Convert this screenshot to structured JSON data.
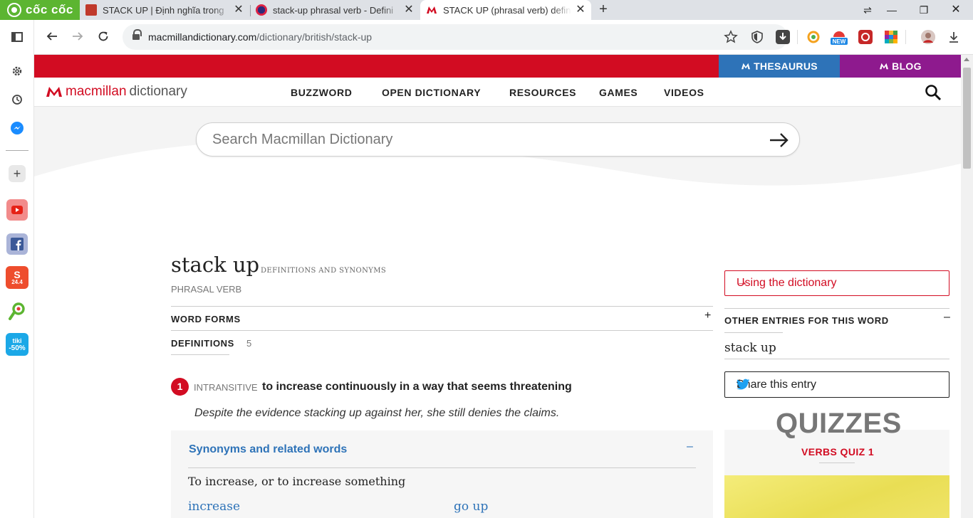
{
  "browser": {
    "brand": "cốc cốc",
    "tabs": [
      {
        "title": "STACK UP | Định nghĩa trong",
        "active": false
      },
      {
        "title": "stack-up phrasal verb - Defini",
        "active": false
      },
      {
        "title": "STACK UP (phrasal verb) defin",
        "active": true
      }
    ],
    "url_domain": "macmillandictionary.com",
    "url_path": "/dictionary/british/stack-up"
  },
  "sidebar": {
    "items": [
      "settings-icon",
      "history-icon",
      "messenger-icon",
      "add-icon",
      "youtube-icon",
      "facebook-icon",
      "shopee-icon",
      "cococ-map-icon",
      "tiki-icon"
    ],
    "shopee_badge": "24.4",
    "tiki_label": "tiki",
    "tiki_badge": "-50%"
  },
  "site": {
    "thesaurus": "THESAURUS",
    "blog": "BLOG",
    "logo_part1": "macmillan",
    "logo_part2": "dictionary",
    "nav": [
      "BUZZWORD",
      "OPEN DICTIONARY",
      "RESOURCES",
      "GAMES",
      "VIDEOS"
    ],
    "search_placeholder": "Search Macmillan Dictionary",
    "colors": {
      "red": "#d20c22",
      "thesaurus": "#2e73b8",
      "blog": "#8e1a8e",
      "link": "#2e73b8"
    }
  },
  "entry": {
    "headword": "stack up",
    "defsyn": "DEFINITIONS AND SYNONYMS",
    "pos": "PHRASAL VERB",
    "word_forms": "WORD FORMS",
    "definitions_label": "DEFINITIONS",
    "definitions_count": "5",
    "sense_number": "1",
    "grammar": "INTRANSITIVE",
    "definition": "to increase continuously in a way that seems threatening",
    "example": "Despite the evidence stacking up against her, she still denies the claims.",
    "synonyms_heading": "Synonyms and related words",
    "synonyms_sense": "To increase, or to increase something",
    "synonyms": [
      "increase",
      "go up"
    ]
  },
  "sidebar_right": {
    "using": "Using the dictionary",
    "other_entries": "OTHER ENTRIES FOR THIS WORD",
    "other_word": "stack up",
    "share": "Share this entry",
    "quizzes": "QUIZZES",
    "quiz_name": "VERBS QUIZ 1"
  }
}
